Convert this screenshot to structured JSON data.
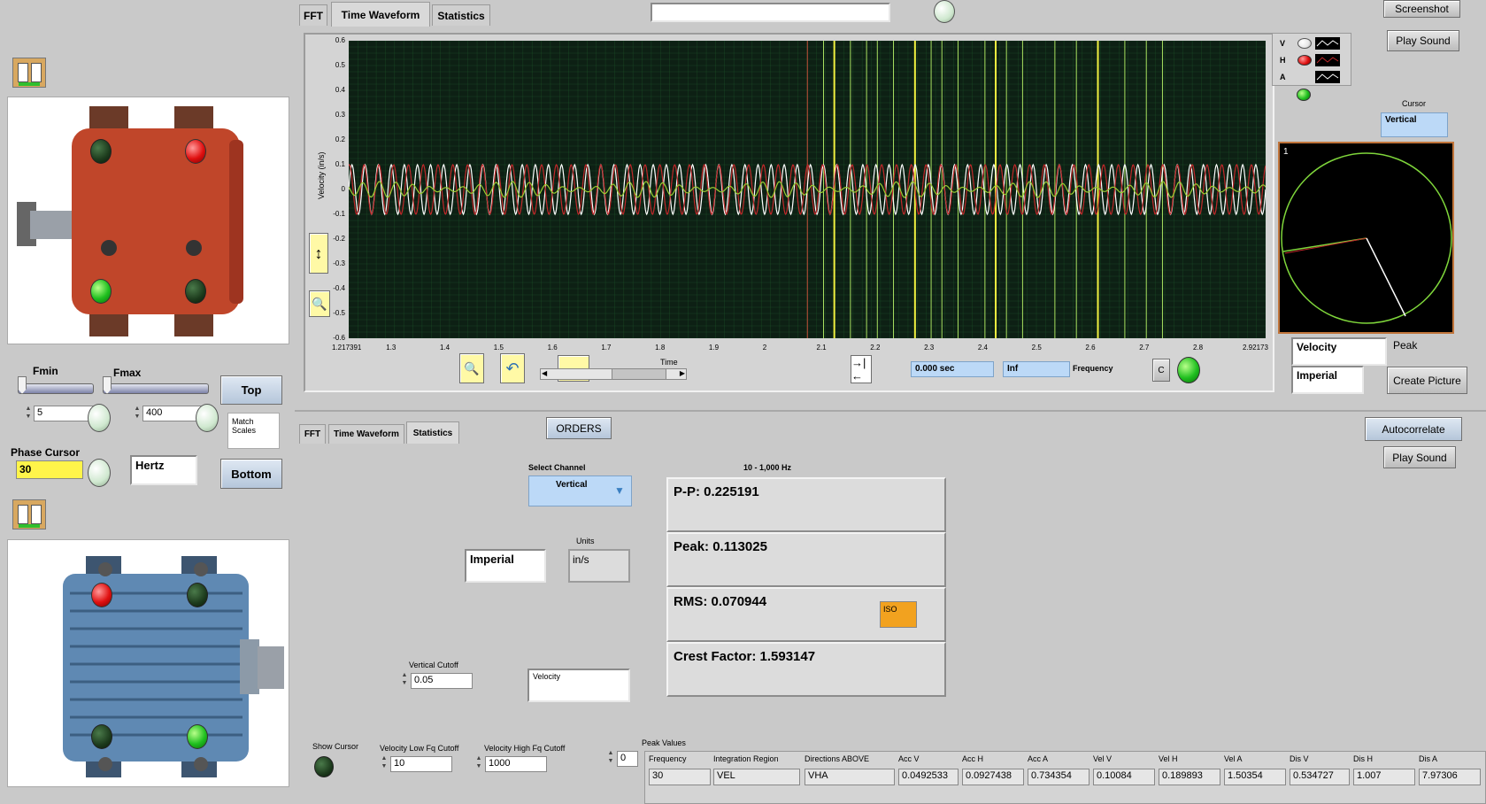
{
  "top_tabs": [
    "FFT",
    "Time Waveform",
    "Statistics"
  ],
  "bottom_tabs": [
    "FFT",
    "Time Waveform",
    "Statistics"
  ],
  "buttons": {
    "screenshot": "Screenshot",
    "play_sound_top": "Play Sound",
    "play_sound_bottom": "Play Sound",
    "create_picture": "Create Picture",
    "autocorrelate": "Autocorrelate",
    "orders": "ORDERS",
    "top": "Top",
    "bottom": "Bottom",
    "c": "C"
  },
  "freq_controls": {
    "fmin_label": "Fmin",
    "fmax_label": "Fmax",
    "fmin_value": "5",
    "fmax_value": "400",
    "match_scales": "Match Scales",
    "phase_cursor_label": "Phase Cursor",
    "phase_cursor_value": "30",
    "units_value": "Hertz"
  },
  "chart": {
    "ylabel": "Velocity (in/s)",
    "y_ticks": [
      "0.6",
      "0.5",
      "0.4",
      "0.3",
      "0.2",
      "0.1",
      "0",
      "-0.1",
      "-0.2",
      "-0.3",
      "-0.4",
      "-0.5",
      "-0.6"
    ],
    "x_ticks": [
      "1.217391",
      "1.3",
      "1.4",
      "1.5",
      "1.6",
      "1.7",
      "1.8",
      "1.9",
      "2",
      "2.1",
      "2.2",
      "2.3",
      "2.4",
      "2.5",
      "2.6",
      "2.7",
      "2.8",
      "2.92173"
    ],
    "xlabel": "Time",
    "time_readout": "0.000 sec",
    "freq_readout": "Inf",
    "freq_label": "Frequency"
  },
  "chart_data": {
    "type": "line",
    "xlabel": "Time",
    "ylabel": "Velocity (in/s)",
    "xlim": [
      1.217391,
      2.92173
    ],
    "ylim": [
      -0.6,
      0.6
    ],
    "grid": true,
    "legend": "top-right",
    "series": [
      {
        "name": "V",
        "color": "#ffffff",
        "amplitude": 0.1,
        "cycles": 70
      },
      {
        "name": "H",
        "color": "#c0282a",
        "amplitude": 0.1,
        "cycles": 62
      },
      {
        "name": "A",
        "color": "#9acd32",
        "amplitude": 0.02,
        "cycles": 55
      }
    ],
    "cursor_lines_x": [
      2.07,
      2.1,
      2.12,
      2.15,
      2.18,
      2.2,
      2.23,
      2.27,
      2.3,
      2.32,
      2.35,
      2.4,
      2.42,
      2.44,
      2.47,
      2.53,
      2.57,
      2.61,
      2.66,
      2.7,
      2.73
    ]
  },
  "legend": {
    "v": "V",
    "h": "H",
    "a": "A"
  },
  "cursor_panel": {
    "cursor_label": "Cursor",
    "cursor_value": "Vertical",
    "polar_index": "1",
    "measure_value": "Velocity",
    "peak_label": "Peak",
    "units_value": "Imperial"
  },
  "stats": {
    "select_channel_label": "Select Channel",
    "select_channel_value": "Vertical",
    "band_label": "10 - 1,000 Hz",
    "units_label": "Units",
    "units_system": "Imperial",
    "units_value": "in/s",
    "pp": "P-P: 0.225191",
    "peak": "Peak: 0.113025",
    "rms": "RMS: 0.070944",
    "crest": "Crest Factor: 1.593147",
    "iso": "ISO",
    "vertical_cutoff_label": "Vertical Cutoff",
    "vertical_cutoff_value": "0.05",
    "measure_value": "Velocity",
    "show_cursor_label": "Show Cursor",
    "vel_low_label": "Velocity Low Fq Cutoff",
    "vel_low_value": "10",
    "vel_high_label": "Velocity High Fq Cutoff",
    "vel_high_value": "1000",
    "peak_values_label": "Peak Values",
    "peak_index": "0"
  },
  "peak_table": {
    "headers": [
      "Frequency",
      "Integration Region",
      "Directions ABOVE",
      "Acc V",
      "Acc H",
      "Acc A",
      "Vel V",
      "Vel H",
      "Vel A",
      "Dis V",
      "Dis H",
      "Dis A"
    ],
    "row": [
      "30",
      "VEL",
      "VHA",
      "0.0492533",
      "0.0927438",
      "0.734354",
      "0.10084",
      "0.189893",
      "1.50354",
      "0.534727",
      "1.007",
      "7.97306"
    ]
  },
  "colors": {
    "plot_bg": "#0d2014",
    "grid": "#1f5a2c",
    "bearing_red": "#c0462a",
    "motor_blue": "#5f89b3",
    "iso": "#f2a21f"
  }
}
